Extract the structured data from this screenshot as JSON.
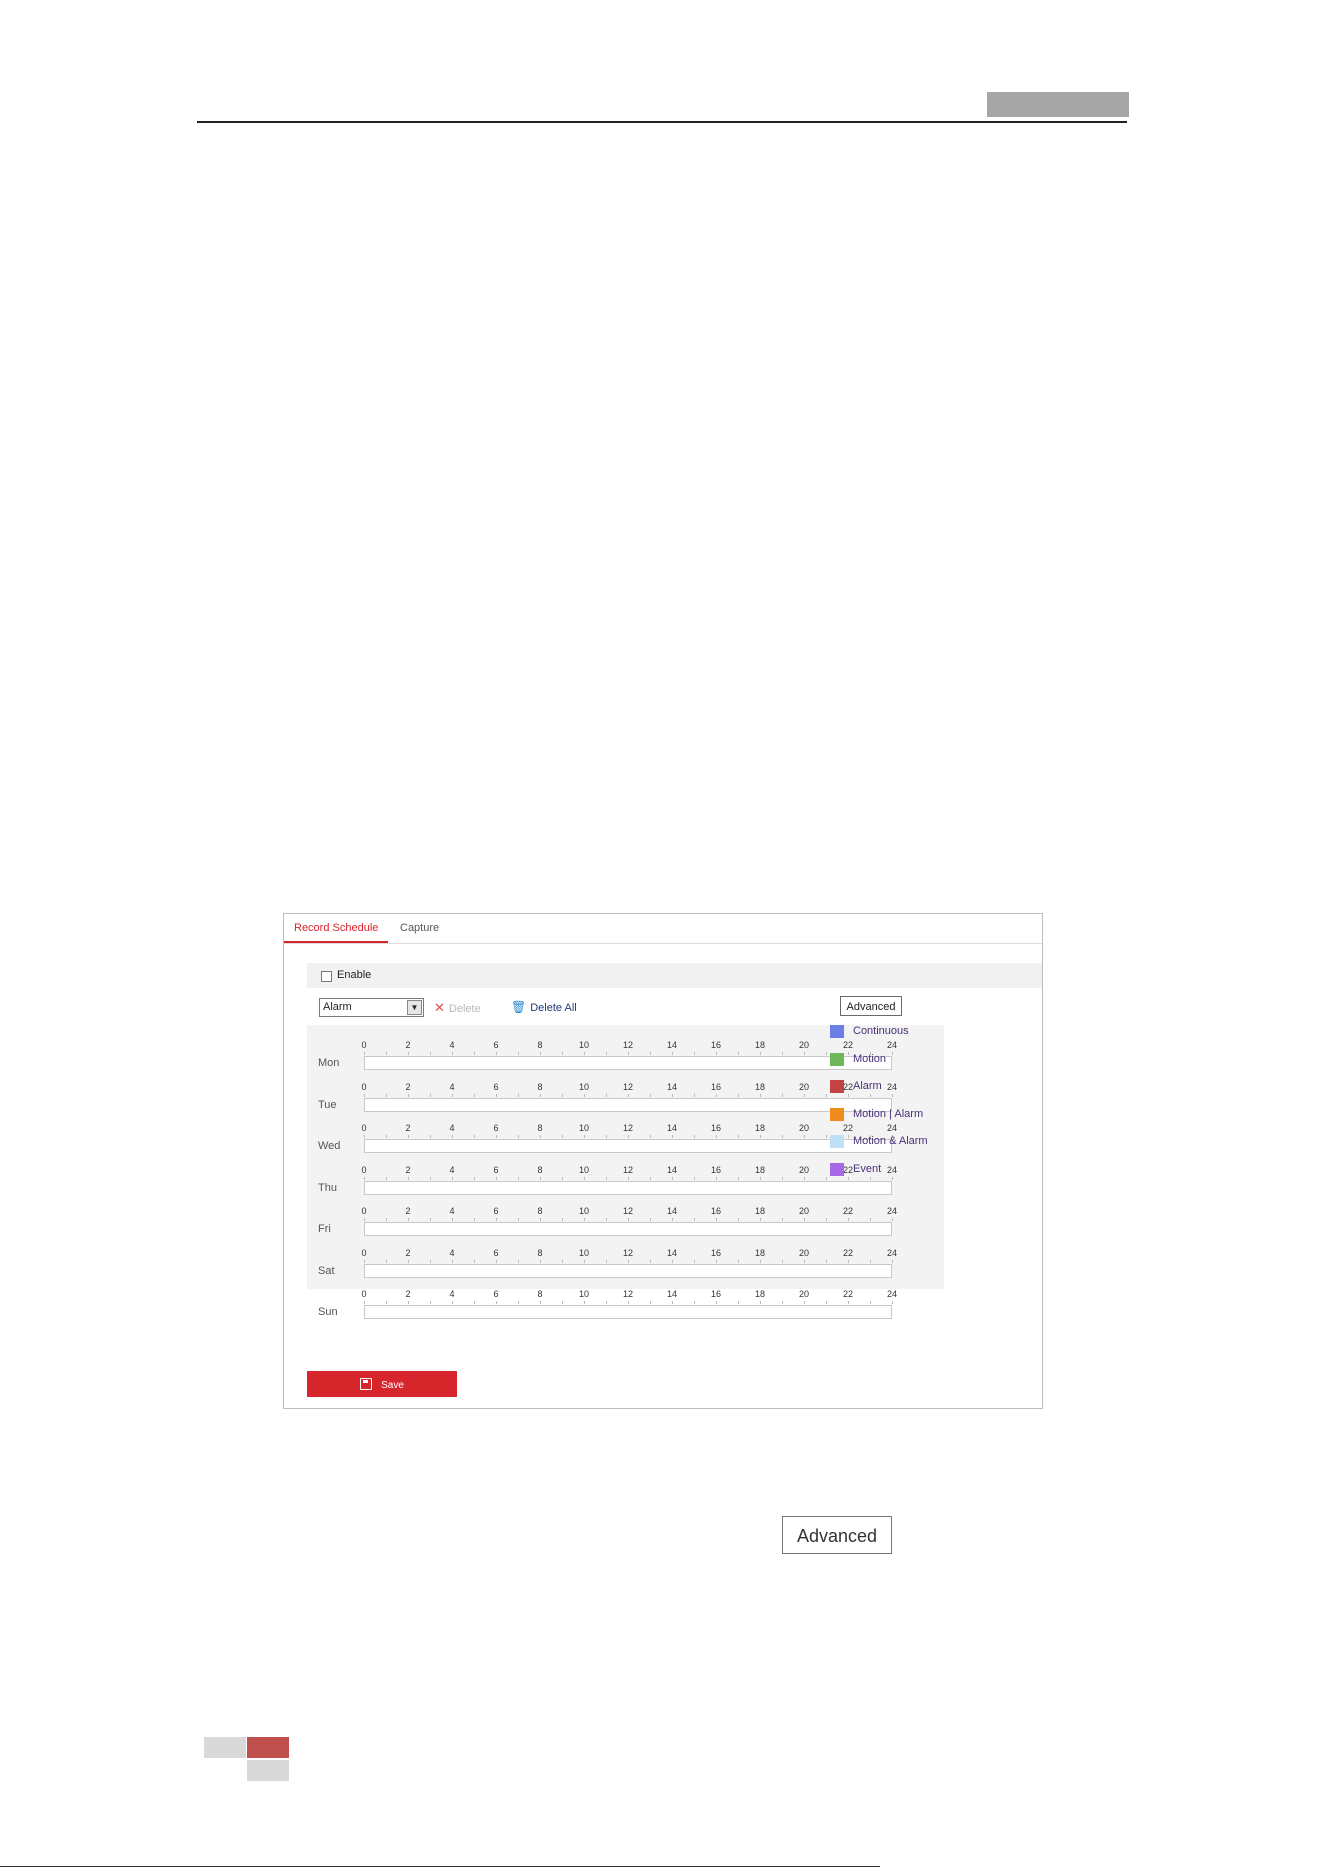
{
  "tabs": [
    {
      "label": "Record Schedule",
      "active": true
    },
    {
      "label": "Capture",
      "active": false
    }
  ],
  "enable_label": "Enable",
  "record_type_select": "Alarm",
  "delete_label": "Delete",
  "delete_all_label": "Delete All",
  "advanced_label": "Advanced",
  "days": [
    "Mon",
    "Tue",
    "Wed",
    "Thu",
    "Fri",
    "Sat",
    "Sun"
  ],
  "hours": [
    "0",
    "2",
    "4",
    "6",
    "8",
    "10",
    "12",
    "14",
    "16",
    "18",
    "20",
    "22",
    "24"
  ],
  "legend": [
    {
      "label": "Continuous",
      "color": "#6a7fe8"
    },
    {
      "label": "Motion",
      "color": "#6fb85a"
    },
    {
      "label": "Alarm",
      "color": "#c24343"
    },
    {
      "label": "Motion | Alarm",
      "color": "#f08c1c"
    },
    {
      "label": "Motion & Alarm",
      "color": "#bfe0f6"
    },
    {
      "label": "Event",
      "color": "#a66ae8"
    }
  ],
  "save_label": "Save",
  "advanced_button_large": "Advanced",
  "colors": {
    "accent": "#d7252c",
    "header_box": "#a6a6a6",
    "footer_accent": "#c0504d"
  }
}
